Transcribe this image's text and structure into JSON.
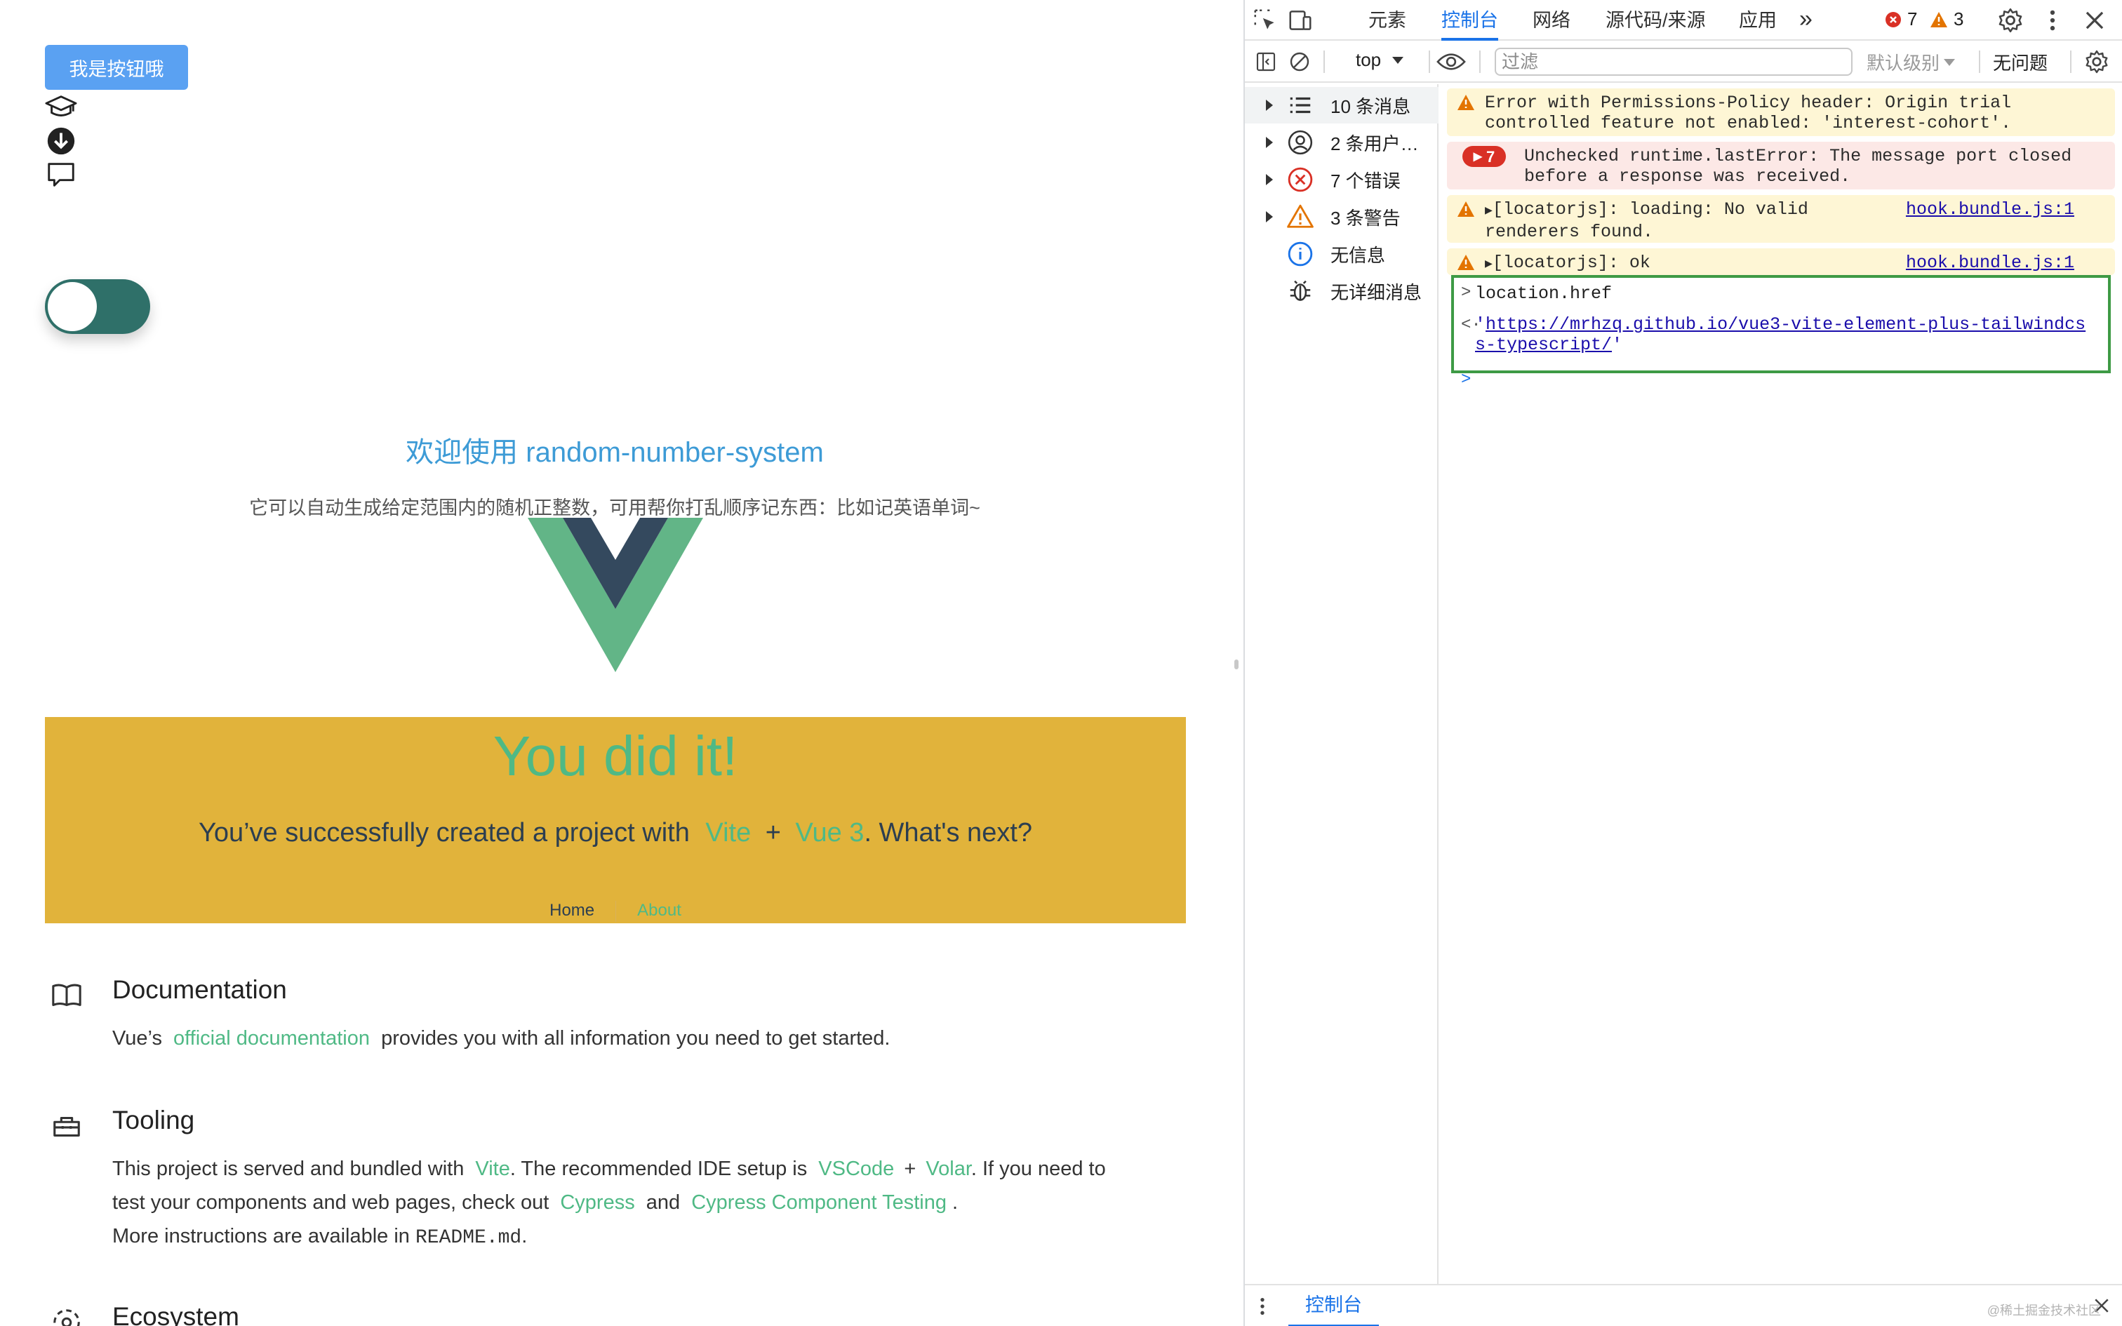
{
  "page": {
    "button_label": "我是按钮哦",
    "welcome": "欢迎使用 random-number-system",
    "subtitle": "它可以自动生成给定范围内的随机正整数，可用帮你打乱顺序记东西：比如记英语单词~",
    "banner": {
      "title": "You did it!",
      "line_prefix": "You’ve successfully created a project with",
      "vite": "Vite",
      "plus": "+",
      "vue3": "Vue 3",
      "line_suffix": ". What's next?",
      "nav_home": "Home",
      "nav_about": "About"
    },
    "sections": {
      "documentation": {
        "title": "Documentation",
        "t1": "Vue’s",
        "link1": "official documentation",
        "t2": "provides you with all information you need to get started."
      },
      "tooling": {
        "title": "Tooling",
        "t1": "This project is served and bundled with",
        "link_vite": "Vite",
        "t2": ". The recommended IDE setup is",
        "link_vscode": "VSCode",
        "plus": "+",
        "link_volar": "Volar",
        "t3": ". If you need to",
        "t4": "test your components and web pages, check out",
        "link_cypress": "Cypress",
        "and": "and",
        "link_cct": "Cypress Component Testing",
        "dot": ".",
        "t5": "More instructions are available in",
        "readme": "README.md",
        "t6": "."
      },
      "ecosystem": {
        "title": "Ecosystem"
      }
    }
  },
  "devtools": {
    "tabs": [
      "元素",
      "控制台",
      "网络",
      "源代码/来源",
      "应用"
    ],
    "more": "»",
    "error_count": "7",
    "warning_count": "3",
    "context": "top",
    "filter_placeholder": "过滤",
    "levels": "默认级别",
    "issues": "无问题",
    "sidebar": [
      {
        "label": "10 条消息",
        "icon": "list-icon"
      },
      {
        "label": "2 条用户…",
        "icon": "user-icon"
      },
      {
        "label": "7 个错误",
        "icon": "error-icon"
      },
      {
        "label": "3 条警告",
        "icon": "warning-icon"
      },
      {
        "label": "无信息",
        "icon": "info-icon"
      },
      {
        "label": "无详细消息",
        "icon": "bug-icon"
      }
    ],
    "messages": {
      "m1_line1": "Error with Permissions-Policy header: Origin trial",
      "m1_line2": "controlled feature not enabled: 'interest-cohort'.",
      "m2_badge": "7",
      "m2_line1": "Unchecked runtime.lastError: The message port closed",
      "m2_line2": "before a response was received.",
      "m3_line1": "[locatorjs]: loading: No valid",
      "m3_line2": "renderers found.",
      "m3_src": "hook.bundle.js:1",
      "m4_line1": "[locatorjs]: ok",
      "m4_src": "hook.bundle.js:1",
      "input": "location.href",
      "output_line1": "https://mrhzq.github.io/vue3-vite-element-plus-tailwindcs",
      "output_line2": "s-typescript/"
    },
    "bottom_tab": "控制台",
    "watermark": "@稀土掘金技术社区"
  },
  "colors": {
    "accent": "#1a73e8",
    "vue_green": "#4fb985",
    "banner": "#e1b33b",
    "highlight": "#3e9a45"
  }
}
